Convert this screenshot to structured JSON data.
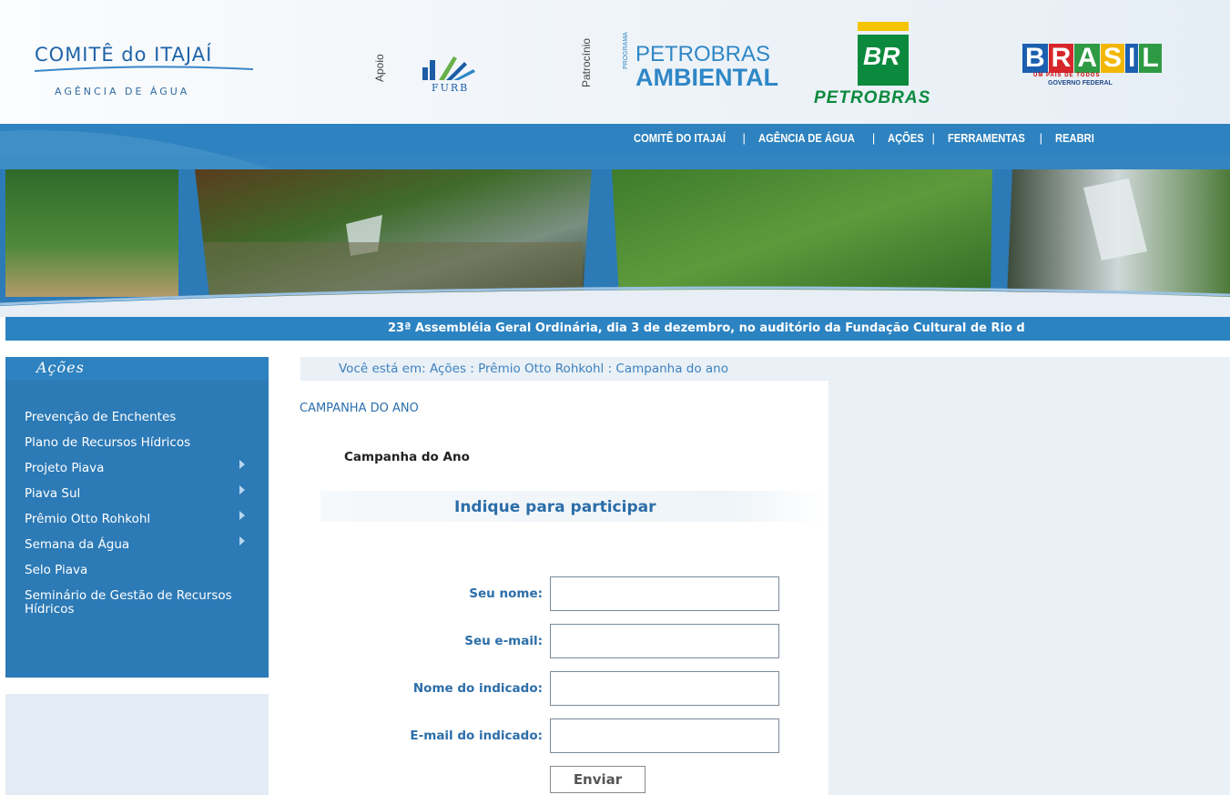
{
  "header": {
    "comite_logo": {
      "title": "COMITÊ do ITAJAÍ",
      "subtitle": "AGÊNCIA DE ÁGUA"
    },
    "support_label": "Apoio",
    "furb_logo": "FURB",
    "sponsor_label": "Patrocínio",
    "petrobras_ambiental": {
      "side": "PROGRAMA",
      "line1": "PETROBRAS",
      "line2": "AMBIENTAL"
    },
    "petrobras_logo": {
      "mark": "BR",
      "name": "PETROBRAS"
    },
    "brasil_logo": {
      "letters": [
        "B",
        "R",
        "A",
        "S",
        "I",
        "L"
      ],
      "letter_colors": [
        "#1b5fb0",
        "#d7262b",
        "#2f9a44",
        "#f2b705",
        "#1b5fb0",
        "#2f9a44"
      ],
      "tagline": "UM PAÍS DE TODOS",
      "gov": "GOVERNO FEDERAL"
    }
  },
  "topnav": {
    "items": [
      "COMITÊ DO ITAJAÍ",
      "AGÊNCIA DE ÁGUA",
      "AÇÕES",
      "FERRAMENTAS",
      "REABRI"
    ],
    "separator": "|"
  },
  "ticker": "23ª Assembléia Geral Ordinária, dia 3 de dezembro, no auditório da Fundação Cultural de Rio d",
  "sidebar": {
    "title": "Ações",
    "items": [
      {
        "label": "Prevenção de Enchentes",
        "submenu": false
      },
      {
        "label": "Plano de Recursos Hídricos",
        "submenu": false
      },
      {
        "label": "Projeto Piava",
        "submenu": true
      },
      {
        "label": "Piava Sul",
        "submenu": true
      },
      {
        "label": "Prêmio Otto Rohkohl",
        "submenu": true
      },
      {
        "label": "Semana da Água",
        "submenu": true
      },
      {
        "label": "Selo Piava",
        "submenu": false
      },
      {
        "label": "Seminário de Gestão de Recursos Hídricos",
        "submenu": false
      }
    ]
  },
  "breadcrumb": "Você está em: Ações : Prêmio Otto Rohkohl : Campanha do ano",
  "page_title": "CAMPANHA DO ANO",
  "section_title": "Campanha do Ano",
  "form": {
    "heading": "Indique para participar",
    "fields": [
      {
        "label": "Seu nome:",
        "value": ""
      },
      {
        "label": "Seu e-mail:",
        "value": ""
      },
      {
        "label": "Nome do indicado:",
        "value": ""
      },
      {
        "label": "E-mail do indicado:",
        "value": ""
      }
    ],
    "submit_label": "Enviar"
  },
  "colors": {
    "nav_blue": "#2d82bf",
    "link_blue": "#2c6ea9",
    "panel_bg": "#e9f0f6",
    "petrobras_green": "#0b8a3e",
    "petrobras_yellow": "#f5c400"
  }
}
